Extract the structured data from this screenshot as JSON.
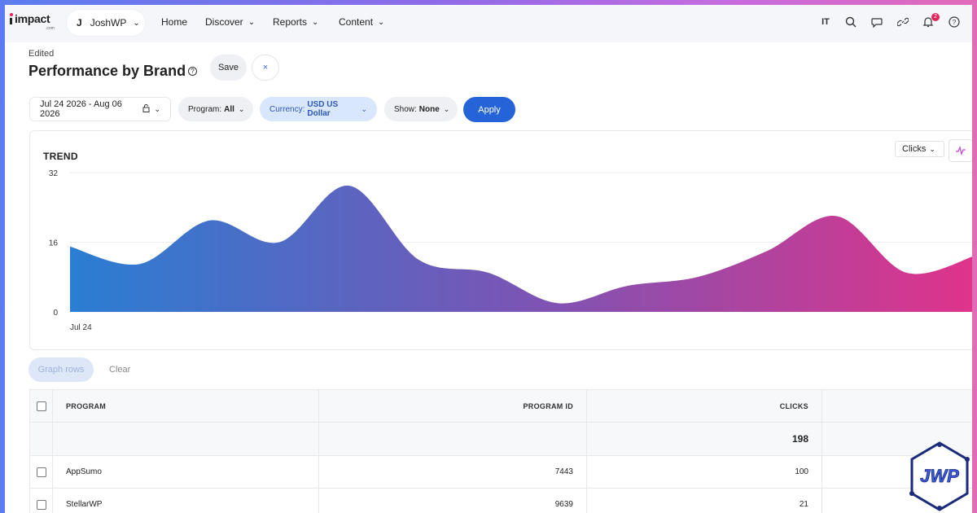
{
  "app": {
    "logo_text": "impact",
    "logo_sub": ".com"
  },
  "nav": {
    "account_initial": "J",
    "account_name": "JoshWP",
    "items": [
      {
        "label": "Home"
      },
      {
        "label": "Discover"
      },
      {
        "label": "Reports"
      },
      {
        "label": "Content"
      }
    ],
    "translate_label": "IT",
    "notification_count": "2"
  },
  "header": {
    "status": "Edited",
    "title": "Performance by Brand",
    "save_label": "Save",
    "close_label": "×"
  },
  "filters": {
    "date_range": "Jul 24 2026 - Aug 06 2026",
    "program_label": "Program:",
    "program_value": "All",
    "currency_label": "Currency:",
    "currency_value": "USD US Dollar",
    "show_label": "Show:",
    "show_value": "None",
    "apply_label": "Apply"
  },
  "trend": {
    "title": "TREND",
    "metric": "Clicks"
  },
  "chart_data": {
    "type": "area",
    "x_start_label": "Jul 24",
    "y_ticks": [
      "32",
      "16",
      "0"
    ],
    "ylim": [
      0,
      32
    ],
    "grid": true,
    "values": [
      15,
      11,
      21,
      16,
      29,
      12,
      9,
      2,
      6,
      8,
      14,
      22,
      9,
      13
    ],
    "colors": {
      "start": "#2a7ed3",
      "mid": "#7a55b5",
      "end": "#e0338a"
    }
  },
  "actions": {
    "graph_rows_label": "Graph rows",
    "clear_label": "Clear"
  },
  "table": {
    "headers": [
      "PROGRAM",
      "PROGRAM ID",
      "CLICKS"
    ],
    "totals": {
      "clicks": "198"
    },
    "rows": [
      {
        "program": "AppSumo",
        "program_id": "7443",
        "clicks": "100"
      },
      {
        "program": "StellarWP",
        "program_id": "9639",
        "clicks": "21"
      }
    ]
  },
  "watermark": {
    "text": "JWP"
  }
}
